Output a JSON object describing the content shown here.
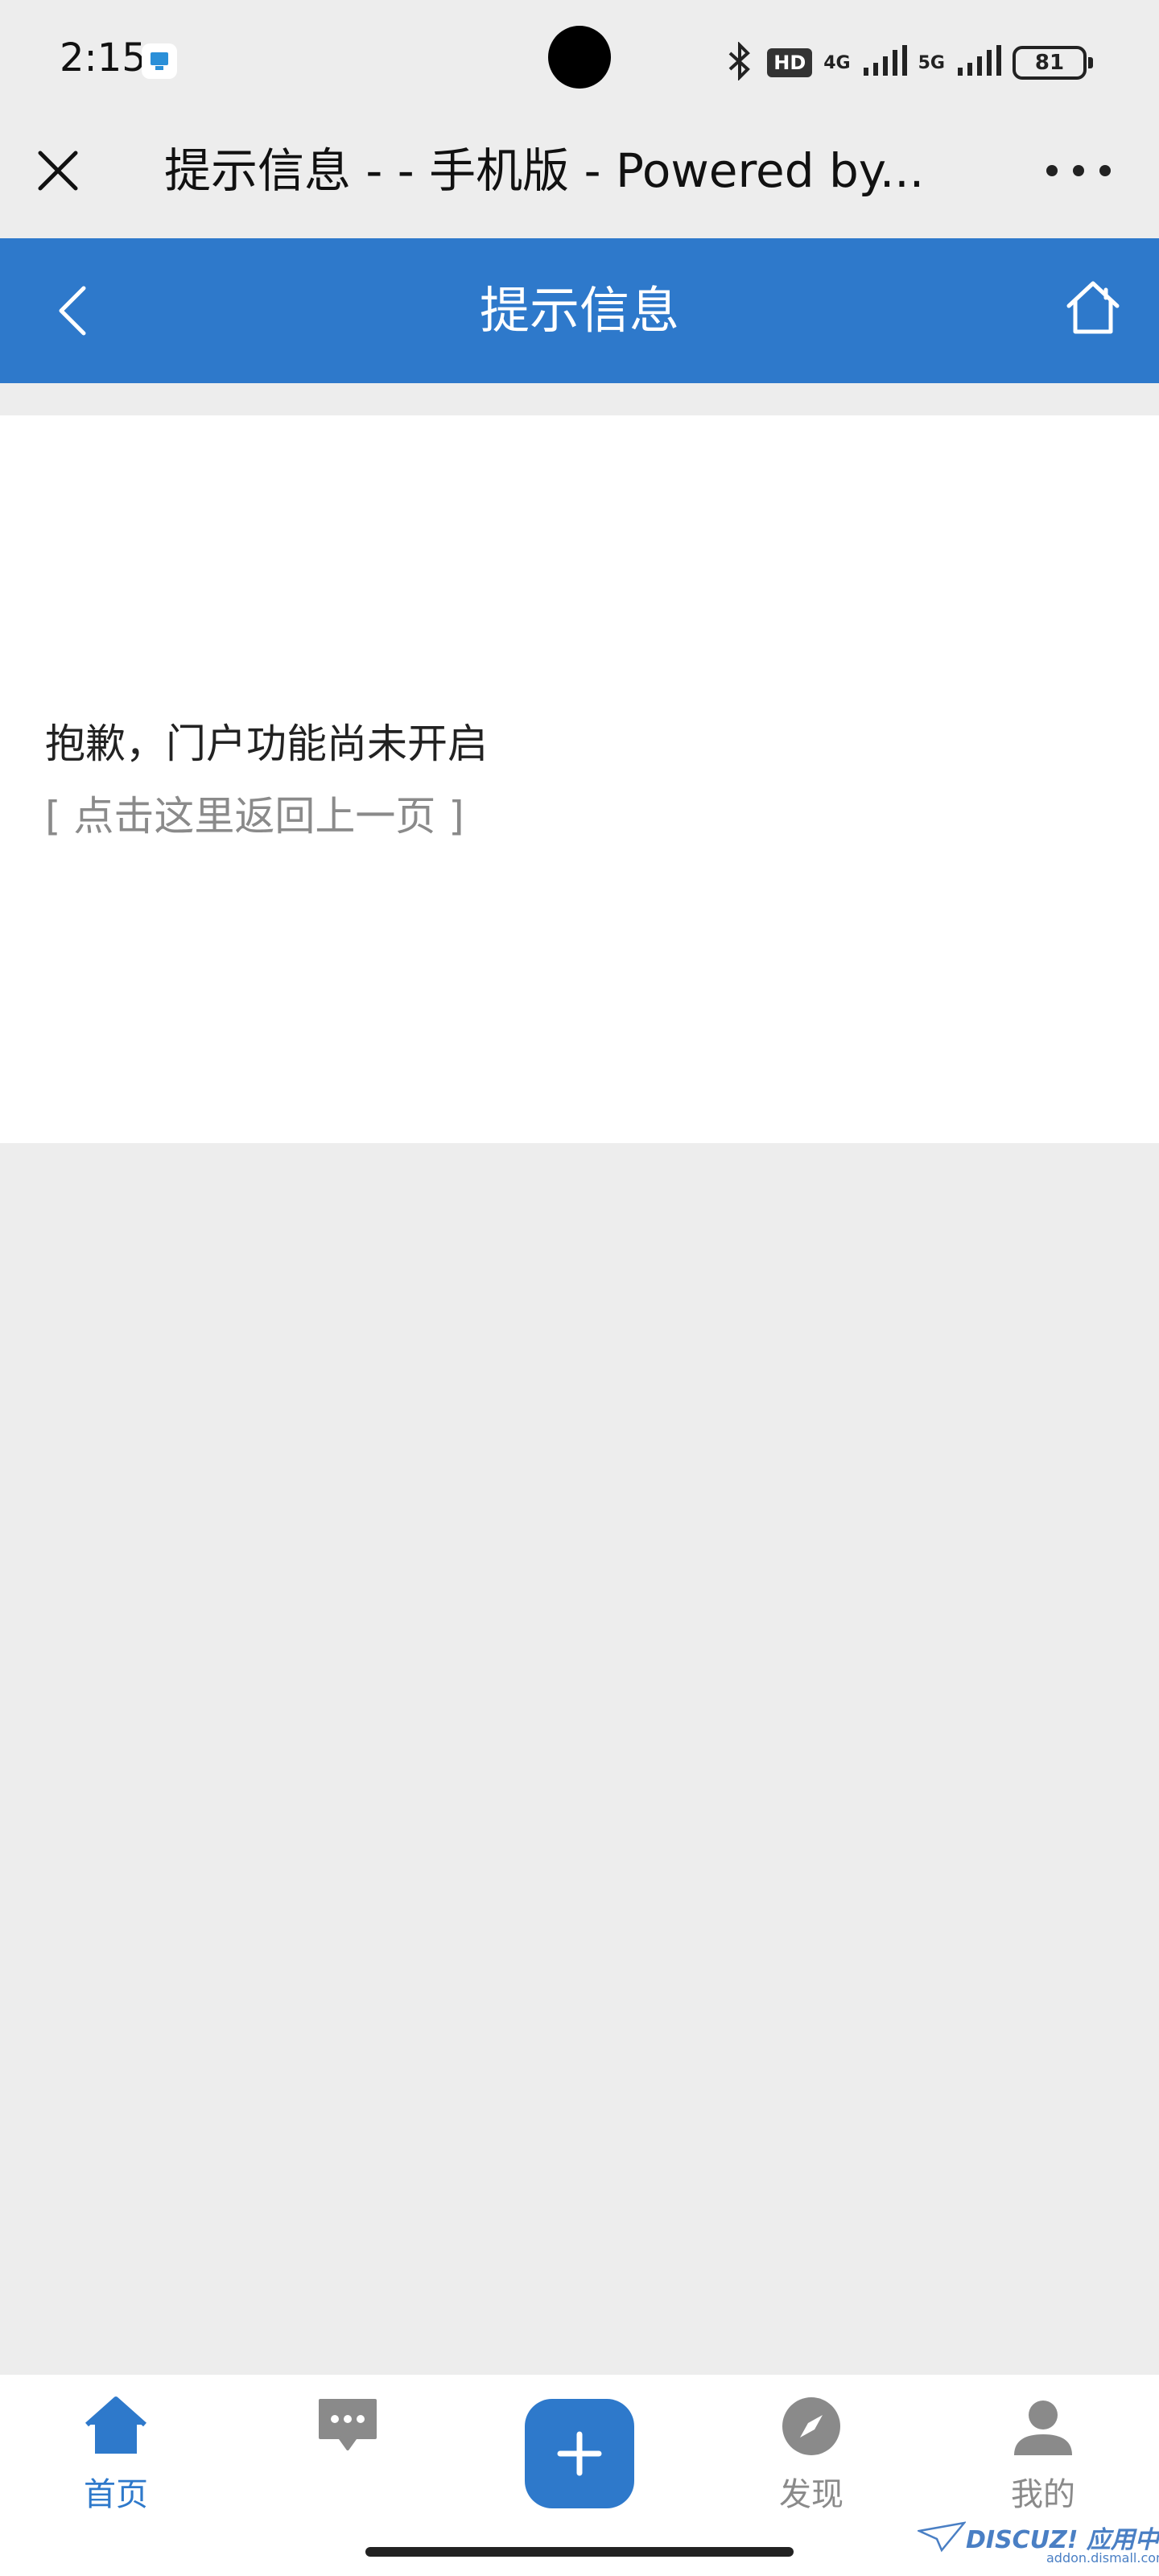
{
  "status_bar": {
    "time": "2:15",
    "hd_label": "HD",
    "net1": "4G",
    "net2": "5G",
    "battery": "81"
  },
  "browser": {
    "title": "提示信息 - - 手机版 - Powered by..."
  },
  "header": {
    "title": "提示信息"
  },
  "content": {
    "message": "抱歉，门户功能尚未开启",
    "back_link": "[ 点击这里返回上一页 ]"
  },
  "bottom_nav": {
    "items": [
      {
        "label": "首页",
        "icon": "home-icon",
        "active": true
      },
      {
        "label": "",
        "icon": "message-icon",
        "active": false
      },
      {
        "label": "",
        "icon": "plus-icon",
        "active": false
      },
      {
        "label": "发现",
        "icon": "compass-icon",
        "active": false
      },
      {
        "label": "我的",
        "icon": "user-icon",
        "active": false
      }
    ]
  },
  "watermark": {
    "brand": "DISCUZ! 应用中心",
    "url": "addon.dismall.com"
  },
  "colors": {
    "accent": "#2e79cb",
    "background": "#ededed",
    "muted": "#8a8a8a"
  }
}
